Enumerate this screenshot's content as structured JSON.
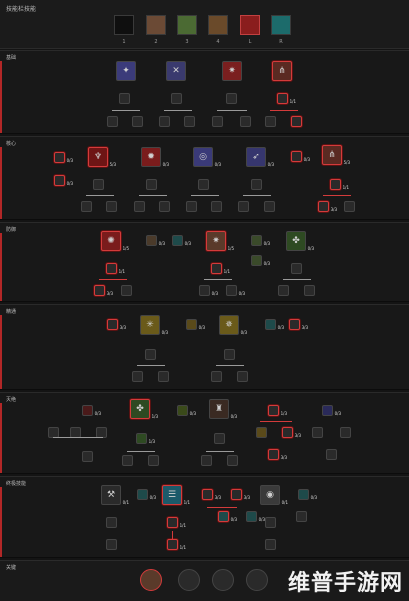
{
  "header": {
    "title": "技能栏技能",
    "slots": [
      {
        "label": "1"
      },
      {
        "label": "2"
      },
      {
        "label": "3"
      },
      {
        "label": "4"
      },
      {
        "label": "L"
      },
      {
        "label": "R"
      }
    ]
  },
  "sections": [
    {
      "title": "基础"
    },
    {
      "title": "核心"
    },
    {
      "title": "防御"
    },
    {
      "title": "精通"
    },
    {
      "title": "灭绝"
    },
    {
      "title": "终极技能"
    }
  ],
  "ranks": {
    "r03": "0/3",
    "r13": "1/3",
    "r33": "3/3",
    "r11": "1/1",
    "r01": "0/1",
    "r53": "5/3",
    "r15": "1/5",
    "r55": "5/5"
  },
  "footer": {
    "title": "关键"
  },
  "watermark": "维普手游网",
  "colors": {
    "accent": "#d33b3b",
    "bar": "#b22727"
  }
}
